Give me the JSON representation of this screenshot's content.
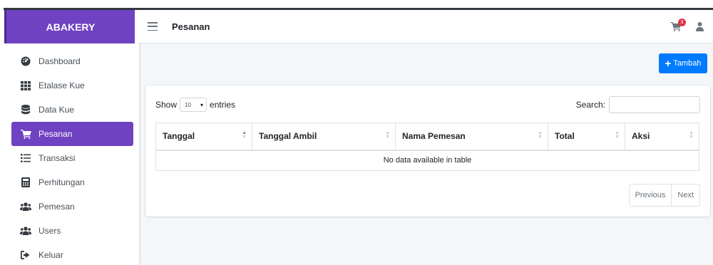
{
  "app": {
    "brand": "ABAKERY"
  },
  "header": {
    "title": "Pesanan",
    "cart_badge": "3"
  },
  "sidebar": {
    "items": [
      {
        "label": "Dashboard",
        "icon": "tachometer-icon"
      },
      {
        "label": "Etalase Kue",
        "icon": "grid-icon"
      },
      {
        "label": "Data Kue",
        "icon": "database-icon"
      },
      {
        "label": "Pesanan",
        "icon": "cart-icon",
        "active": true
      },
      {
        "label": "Transaksi",
        "icon": "list-icon"
      },
      {
        "label": "Perhitungan",
        "icon": "calculator-icon"
      },
      {
        "label": "Pemesan",
        "icon": "users-icon"
      },
      {
        "label": "Users",
        "icon": "users-icon"
      },
      {
        "label": "Keluar",
        "icon": "sign-out-icon"
      }
    ]
  },
  "toolbar": {
    "add_label": "Tambah"
  },
  "table_controls": {
    "show_label": "Show",
    "entries_value": "10",
    "entries_label": "entries",
    "search_label": "Search:",
    "search_value": ""
  },
  "table": {
    "columns": [
      "Tanggal",
      "Tanggal Ambil",
      "Nama Pemesan",
      "Total",
      "Aksi"
    ],
    "empty_message": "No data available in table"
  },
  "pagination": {
    "previous": "Previous",
    "next": "Next"
  },
  "colors": {
    "accent": "#6f42c1",
    "primary": "#007bff",
    "badge": "#dc3545"
  }
}
